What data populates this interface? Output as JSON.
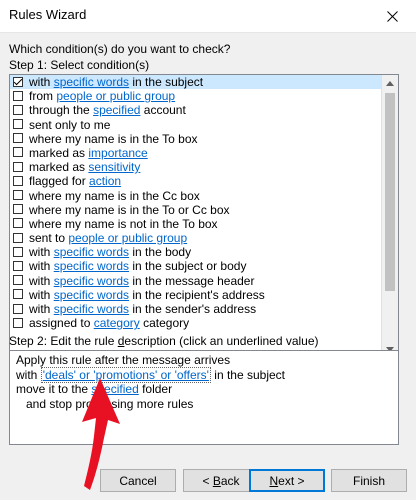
{
  "window": {
    "title": "Rules Wizard"
  },
  "question": "Which condition(s) do you want to check?",
  "step1": {
    "label": "Step 1: Select condition(s)"
  },
  "conditions": [
    {
      "checked": true,
      "selected": true,
      "parts": [
        {
          "t": "with "
        },
        {
          "t": "specific words",
          "l": true
        },
        {
          "t": " in the subject"
        }
      ]
    },
    {
      "checked": false,
      "selected": false,
      "parts": [
        {
          "t": "from "
        },
        {
          "t": "people or public group",
          "l": true
        }
      ]
    },
    {
      "checked": false,
      "selected": false,
      "parts": [
        {
          "t": "through the "
        },
        {
          "t": "specified",
          "l": true
        },
        {
          "t": " account"
        }
      ]
    },
    {
      "checked": false,
      "selected": false,
      "parts": [
        {
          "t": "sent only to me"
        }
      ]
    },
    {
      "checked": false,
      "selected": false,
      "parts": [
        {
          "t": "where my name is in the To box"
        }
      ]
    },
    {
      "checked": false,
      "selected": false,
      "parts": [
        {
          "t": "marked as "
        },
        {
          "t": "importance",
          "l": true
        }
      ]
    },
    {
      "checked": false,
      "selected": false,
      "parts": [
        {
          "t": "marked as "
        },
        {
          "t": "sensitivity",
          "l": true
        }
      ]
    },
    {
      "checked": false,
      "selected": false,
      "parts": [
        {
          "t": "flagged for "
        },
        {
          "t": "action",
          "l": true
        }
      ]
    },
    {
      "checked": false,
      "selected": false,
      "parts": [
        {
          "t": "where my name is in the Cc box"
        }
      ]
    },
    {
      "checked": false,
      "selected": false,
      "parts": [
        {
          "t": "where my name is in the To or Cc box"
        }
      ]
    },
    {
      "checked": false,
      "selected": false,
      "parts": [
        {
          "t": "where my name is not in the To box"
        }
      ]
    },
    {
      "checked": false,
      "selected": false,
      "parts": [
        {
          "t": "sent to "
        },
        {
          "t": "people or public group",
          "l": true
        }
      ]
    },
    {
      "checked": false,
      "selected": false,
      "parts": [
        {
          "t": "with "
        },
        {
          "t": "specific words",
          "l": true
        },
        {
          "t": " in the body"
        }
      ]
    },
    {
      "checked": false,
      "selected": false,
      "parts": [
        {
          "t": "with "
        },
        {
          "t": "specific words",
          "l": true
        },
        {
          "t": " in the subject or body"
        }
      ]
    },
    {
      "checked": false,
      "selected": false,
      "parts": [
        {
          "t": "with "
        },
        {
          "t": "specific words",
          "l": true
        },
        {
          "t": " in the message header"
        }
      ]
    },
    {
      "checked": false,
      "selected": false,
      "parts": [
        {
          "t": "with "
        },
        {
          "t": "specific words",
          "l": true
        },
        {
          "t": " in the recipient's address"
        }
      ]
    },
    {
      "checked": false,
      "selected": false,
      "parts": [
        {
          "t": "with "
        },
        {
          "t": "specific words",
          "l": true
        },
        {
          "t": " in the sender's address"
        }
      ]
    },
    {
      "checked": false,
      "selected": false,
      "parts": [
        {
          "t": "assigned to "
        },
        {
          "t": "category",
          "l": true
        },
        {
          "t": " category"
        }
      ]
    }
  ],
  "step2": {
    "label_pre": "Step 2: Edit the rule ",
    "label_u": "d",
    "label_post": "escription (click an underlined value)"
  },
  "description": {
    "line1": "Apply this rule after the message arrives",
    "line2_pre": "with ",
    "line2_link": "'deals' or 'promotions' or 'offers'",
    "line2_post": " in the subject",
    "line3_pre": "move it to the ",
    "line3_link": "specified",
    "line3_post": " folder",
    "line4": "and stop processing more rules"
  },
  "buttons": {
    "cancel": "Cancel",
    "back_u": "B",
    "back_rest": "ack",
    "next_u": "N",
    "next_rest": "ext >",
    "finish": "Finish"
  },
  "colors": {
    "link": "#0066cc",
    "selection": "#cce8ff",
    "annotation_arrow": "#e81123",
    "default_button_border": "#0078d7"
  },
  "icons": {
    "close": "close-icon",
    "checkbox": "checkbox",
    "annotation": "red-arrow-icon"
  }
}
